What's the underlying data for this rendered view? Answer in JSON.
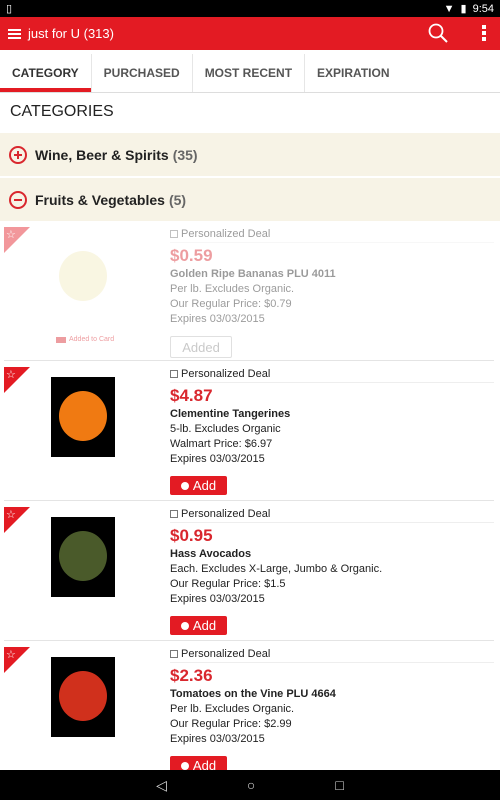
{
  "status": {
    "time": "9:54"
  },
  "appbar": {
    "title": "just for U (313)"
  },
  "tabs": [
    {
      "label": "CATEGORY",
      "active": true
    },
    {
      "label": "PURCHASED"
    },
    {
      "label": "MOST RECENT"
    },
    {
      "label": "EXPIRATION"
    }
  ],
  "section_title": "CATEGORIES",
  "categories": [
    {
      "name": "Wine, Beer & Spirits",
      "count": "(35)",
      "expanded": false
    },
    {
      "name": "Fruits & Vegetables",
      "count": "(5)",
      "expanded": true
    }
  ],
  "items": [
    {
      "deal": "Personalized Deal",
      "price": "$0.59",
      "name": "Golden Ripe Bananas PLU 4011",
      "desc": "Per lb. Excludes Organic.",
      "regular": "Our Regular Price: $0.79",
      "expires": "Expires 03/03/2015",
      "button": "Added",
      "added_label": "Added to Card",
      "image_color": "#f3ecc0"
    },
    {
      "deal": "Personalized Deal",
      "price": "$4.87",
      "name": "Clementine Tangerines",
      "desc": "5-lb. Excludes Organic",
      "regular": "Walmart Price: $6.97",
      "expires": "Expires 03/03/2015",
      "button": "Add",
      "image_color": "#f07a12"
    },
    {
      "deal": "Personalized Deal",
      "price": "$0.95",
      "name": "Hass Avocados",
      "desc": "Each. Excludes X-Large, Jumbo & Organic.",
      "regular": "Our Regular Price: $1.5",
      "expires": "Expires 03/03/2015",
      "button": "Add",
      "image_color": "#4a5a2a"
    },
    {
      "deal": "Personalized Deal",
      "price": "$2.36",
      "name": "Tomatoes on the Vine PLU 4664",
      "desc": "Per lb. Excludes Organic.",
      "regular": "Our Regular Price: $2.99",
      "expires": "Expires 03/03/2015",
      "button": "Add",
      "image_color": "#d0301c"
    }
  ],
  "colors": {
    "brand": "#e31b23",
    "category_bg": "#f7f3e6"
  }
}
